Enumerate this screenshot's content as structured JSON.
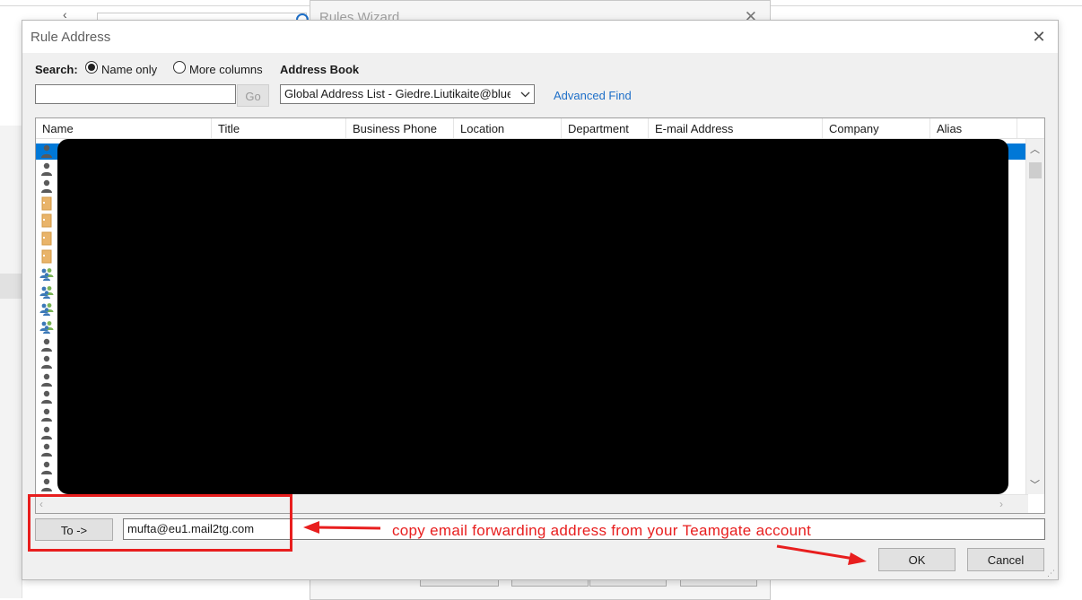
{
  "background": {
    "wizard_title": "Rules Wizard"
  },
  "dialog": {
    "title": "Rule Address",
    "close_glyph": "✕",
    "search_label": "Search:",
    "radio_name_only": "Name only",
    "radio_more_columns": "More columns",
    "name_only_selected": true,
    "address_book_label": "Address Book",
    "go_label": "Go",
    "search_value": "",
    "address_book_value": "Global Address List - Giedre.Liutikaite@blue",
    "advanced_find": "Advanced Find",
    "columns": [
      "Name",
      "Title",
      "Business Phone",
      "Location",
      "Department",
      "E-mail Address",
      "Company",
      "Alias"
    ],
    "row_icons": [
      "person-icon",
      "person-icon",
      "person-icon",
      "folder-contact-icon",
      "folder-contact-icon",
      "folder-contact-icon",
      "folder-contact-icon",
      "group-icon",
      "group-icon",
      "group-icon",
      "group-icon",
      "person-icon",
      "person-icon",
      "person-icon",
      "person-icon",
      "person-icon",
      "person-icon",
      "person-icon",
      "person-icon",
      "person-icon"
    ],
    "to_button": "To ->",
    "to_value": "mufta@eu1.mail2tg.com",
    "ok": "OK",
    "cancel": "Cancel"
  },
  "annotation": {
    "text": "copy email forwarding address from your Teamgate account",
    "color": "#e81e1e"
  },
  "colors": {
    "link": "#1e6fc8",
    "selection": "#0078d7",
    "redaction": "#000000"
  }
}
